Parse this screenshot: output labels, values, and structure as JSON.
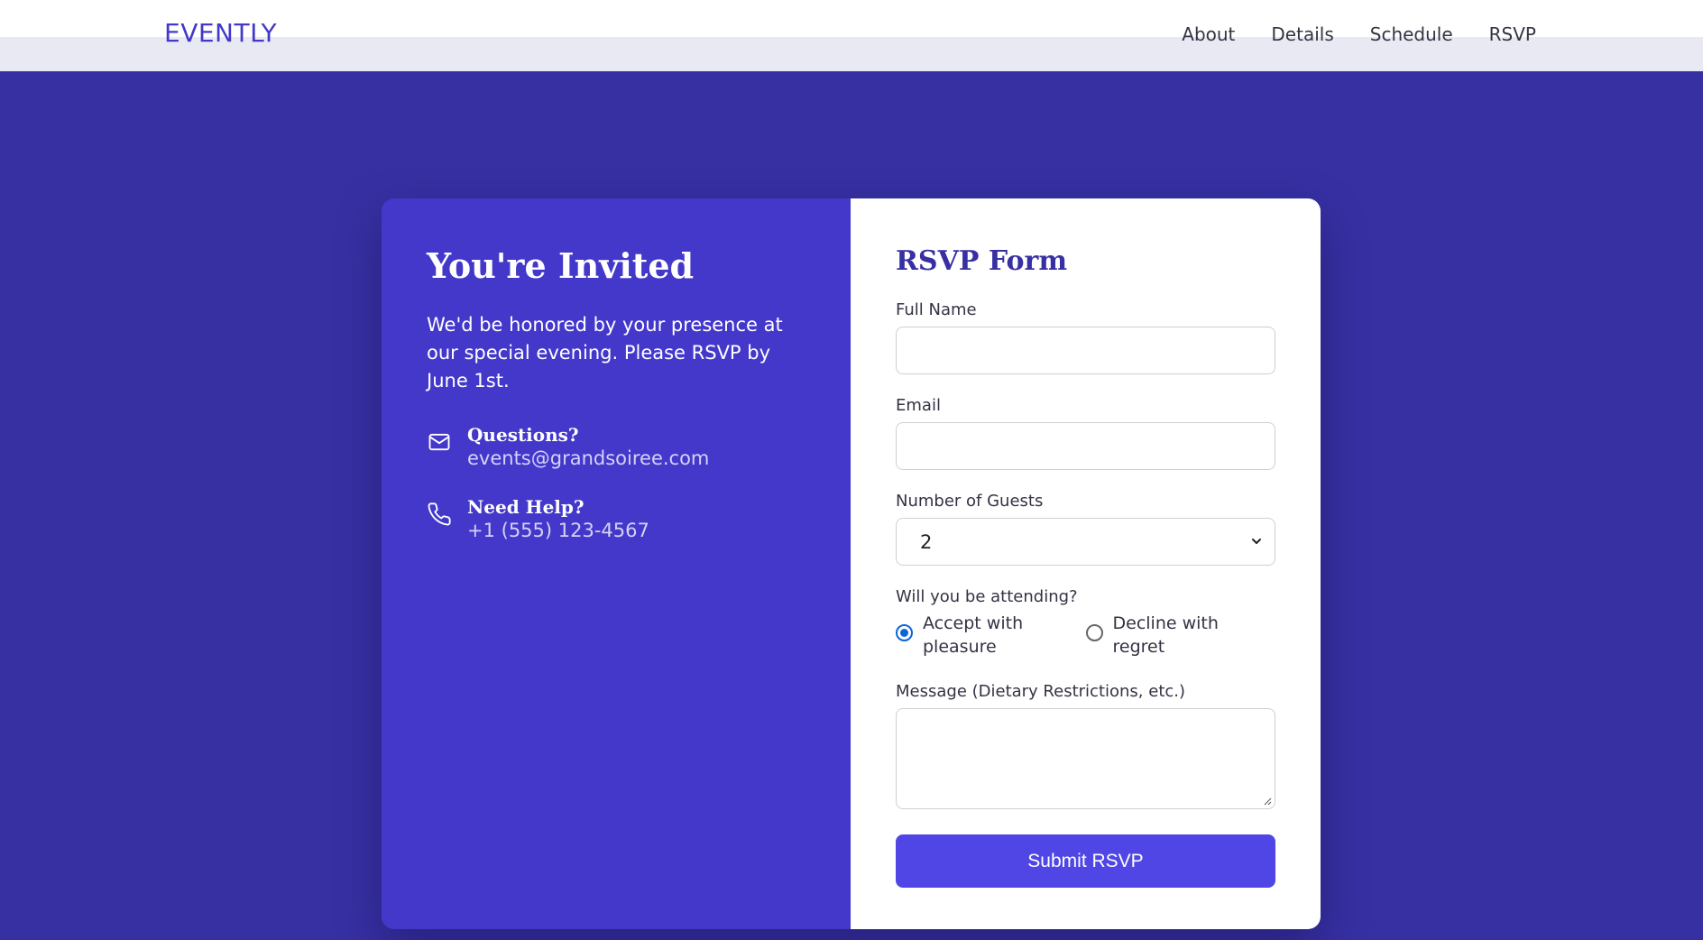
{
  "header": {
    "logo": "EVENTLY",
    "nav": [
      "About",
      "Details",
      "Schedule",
      "RSVP"
    ]
  },
  "invite": {
    "title": "You're Invited",
    "intro": "We'd be honored by your presence at our special evening. Please RSVP by June 1st.",
    "contacts": [
      {
        "icon": "mail-icon",
        "title": "Questions?",
        "value": "events@grandsoiree.com"
      },
      {
        "icon": "phone-icon",
        "title": "Need Help?",
        "value": "+1 (555) 123-4567"
      }
    ]
  },
  "form": {
    "title": "RSVP Form",
    "full_name_label": "Full Name",
    "full_name_value": "",
    "email_label": "Email",
    "email_value": "",
    "guests_label": "Number of Guests",
    "guests_value": "2",
    "attending_label": "Will you be attending?",
    "attending_options": [
      "Accept with pleasure",
      "Decline with regret"
    ],
    "attending_selected": "Accept with pleasure",
    "message_label": "Message (Dietary Restrictions, etc.)",
    "message_value": "",
    "submit_label": "Submit RSVP"
  },
  "colors": {
    "background": "#3730a3",
    "left_panel": "#4438cb",
    "accent": "#4f46e5",
    "heading": "#3730a3"
  }
}
